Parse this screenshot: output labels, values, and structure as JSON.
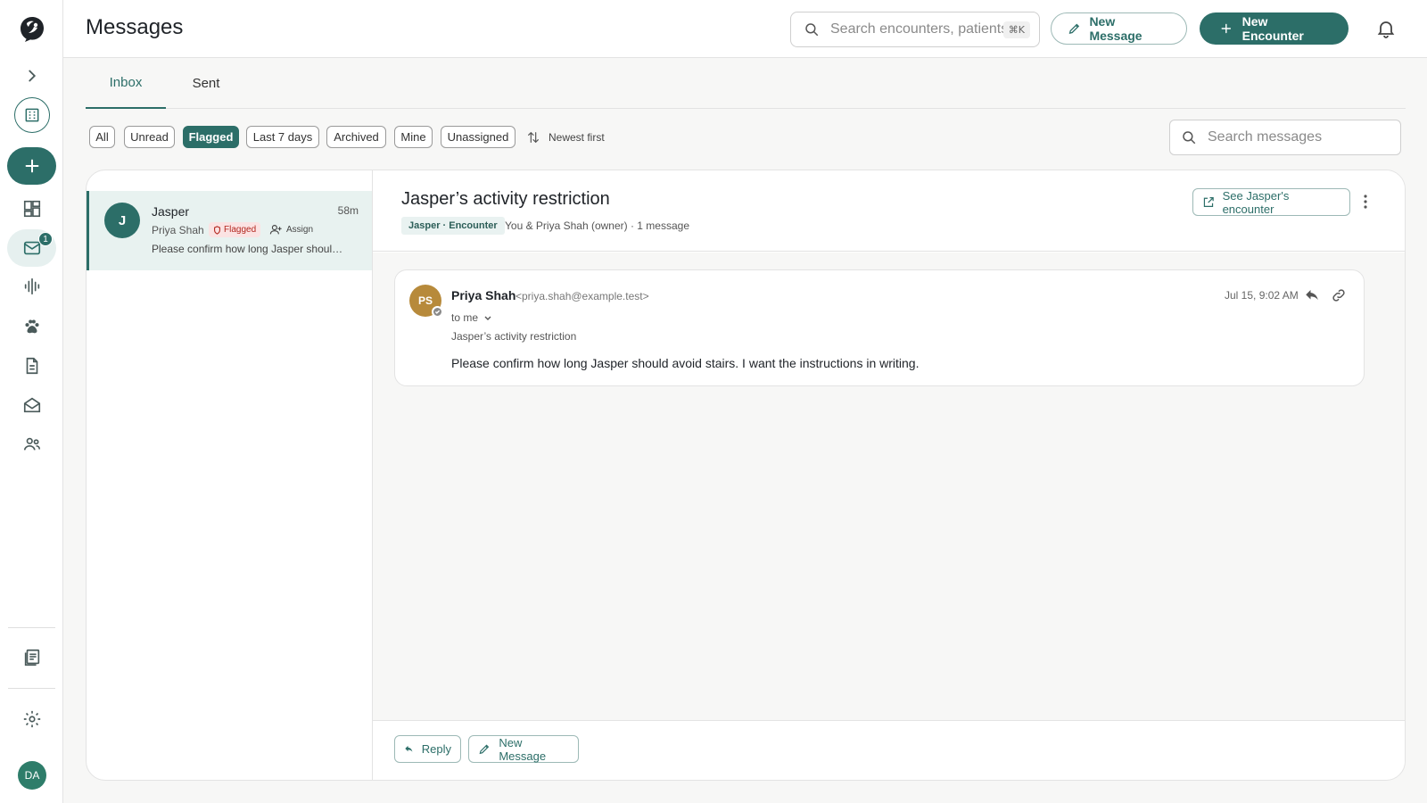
{
  "header": {
    "title": "Messages",
    "search_placeholder": "Search encounters, patients",
    "search_shortcut": "⌘K",
    "new_message_label": "New Message",
    "new_encounter_label": "New Encounter"
  },
  "sidebar": {
    "inbox_badge": "1",
    "user_initials": "DA",
    "icons": [
      "parrot-logo-icon",
      "chevron-right-icon",
      "clinic-icon",
      "plus-icon",
      "dashboard-icon",
      "inbox-icon",
      "audio-wave-icon",
      "paw-icon",
      "document-icon",
      "mail-open-icon",
      "people-icon",
      "notes-icon",
      "gear-icon"
    ]
  },
  "tabs": [
    {
      "label": "Inbox",
      "active": true
    },
    {
      "label": "Sent",
      "active": false
    }
  ],
  "filters": [
    {
      "label": "All",
      "active": false
    },
    {
      "label": "Unread",
      "active": false
    },
    {
      "label": "Flagged",
      "active": true
    },
    {
      "label": "Last 7 days",
      "active": false
    },
    {
      "label": "Archived",
      "active": false
    },
    {
      "label": "Mine",
      "active": false
    },
    {
      "label": "Unassigned",
      "active": false
    }
  ],
  "sort_label": "Newest first",
  "message_search_placeholder": "Search messages",
  "conversations": [
    {
      "avatar_letter": "J",
      "name": "Jasper",
      "time": "58m",
      "from": "Priya Shah",
      "flag_label": "Flagged",
      "assign_label": "Assign",
      "preview": "Please confirm how long Jasper should avoid stairs. I want the instructions in writing."
    }
  ],
  "thread": {
    "title": "Jasper’s activity restriction",
    "encounter_chip": "Jasper · Encounter",
    "meta": "You & Priya Shah (owner) · 1 message",
    "see_encounter_label": "See Jasper's encounter",
    "messages": [
      {
        "initials": "PS",
        "sender": "Priya Shah",
        "email": "<priya.shah@example.test>",
        "to": "to me",
        "subject": "Jasper’s activity restriction",
        "date": "Jul 15, 9:02 AM",
        "body": "Please confirm how long Jasper should avoid stairs. I want the instructions in writing."
      }
    ],
    "reply_label": "Reply",
    "new_message_label": "New Message"
  },
  "colors": {
    "accent": "#2c6e68",
    "flag_bg": "#fbe3e3",
    "flag_text": "#b3261e",
    "sender_avatar": "#b78a3b"
  }
}
